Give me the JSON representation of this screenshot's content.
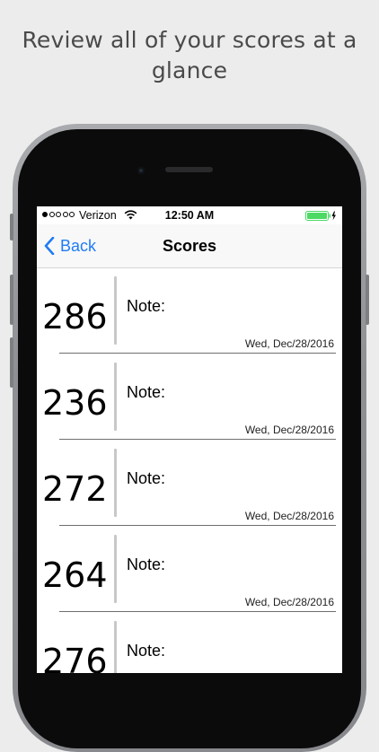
{
  "promo": {
    "title": "Review all of your scores at a glance"
  },
  "status_bar": {
    "carrier": "Verizon",
    "time": "12:50 AM",
    "signal_bars_filled": 1,
    "signal_bars_total": 5,
    "battery_color": "#4cd964"
  },
  "nav": {
    "back_label": "Back",
    "title": "Scores",
    "accent_color": "#1f7cf5"
  },
  "scores": [
    {
      "value": "286",
      "note_label": "Note:",
      "date": "Wed, Dec/28/2016"
    },
    {
      "value": "236",
      "note_label": "Note:",
      "date": "Wed, Dec/28/2016"
    },
    {
      "value": "272",
      "note_label": "Note:",
      "date": "Wed, Dec/28/2016"
    },
    {
      "value": "264",
      "note_label": "Note:",
      "date": "Wed, Dec/28/2016"
    },
    {
      "value": "276",
      "note_label": "Note:",
      "date": ""
    }
  ]
}
